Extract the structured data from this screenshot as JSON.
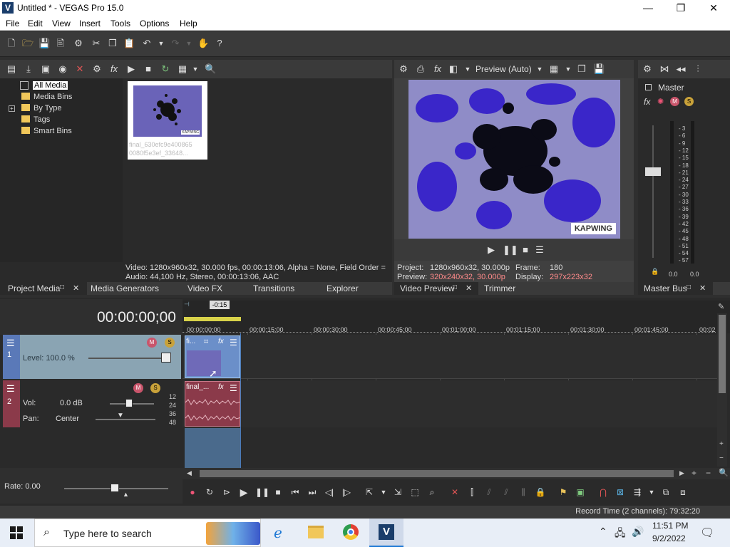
{
  "window": {
    "title": "Untitled * - VEGAS Pro 15.0",
    "app_icon_letter": "V",
    "minimize": "—",
    "maximize": "❐",
    "close": "✕"
  },
  "menu": [
    "File",
    "Edit",
    "View",
    "Insert",
    "Tools",
    "Options",
    "Help"
  ],
  "project_media": {
    "tree": [
      "All Media",
      "Media Bins",
      "By Type",
      "Tags",
      "Smart Bins"
    ],
    "expand_marker": "+",
    "thumbnail_caption": [
      "final_630efc9e400865",
      "0080f5e3ef_33648..."
    ],
    "thumbnail_watermark": "KAPWING",
    "info_video": "Video: 1280x960x32, 30.000 fps, 00:00:13:06, Alpha = None, Field Order =",
    "info_audio": "Audio: 44,100 Hz, Stereo, 00:00:13:06, AAC",
    "tabs": [
      "Project Media",
      "Media Generators",
      "Video FX",
      "Transitions",
      "Explorer"
    ],
    "tab_close": "✕"
  },
  "preview": {
    "mode": "Preview (Auto)",
    "watermark": "KAPWING",
    "project_label": "Project:",
    "project_value": "1280x960x32, 30.000p",
    "preview_label": "Preview:",
    "preview_value": "320x240x32, 30.000p",
    "frame_label": "Frame:",
    "frame_value": "180",
    "display_label": "Display:",
    "display_value": "297x223x32",
    "tabs": [
      "Video Preview",
      "Trimmer"
    ],
    "tab_close": "✕"
  },
  "master": {
    "label": "Master",
    "scale": [
      "3",
      "6",
      "9",
      "12",
      "15",
      "18",
      "21",
      "24",
      "27",
      "30",
      "33",
      "36",
      "39",
      "42",
      "45",
      "48",
      "51",
      "54",
      "57"
    ],
    "left_value": "0.0",
    "right_value": "0.0",
    "tab": "Master Bus",
    "tab_close": "✕"
  },
  "timeline": {
    "timecode": "00:00:00;00",
    "cursor_offset": "-0:15",
    "ruler": [
      "00:00:00;00",
      "00:00:15;00",
      "00:00:30;00",
      "00:00:45;00",
      "00:01:00;00",
      "00:01:15;00",
      "00:01:30;00",
      "00:01:45;00",
      "00:02"
    ],
    "video_track": {
      "number": "1",
      "level": "Level: 100.0 %",
      "clip_label": "fi..."
    },
    "audio_track": {
      "number": "2",
      "vol_label": "Vol:",
      "vol_value": "0.0 dB",
      "pan_label": "Pan:",
      "pan_value": "Center",
      "db_scale": [
        "12",
        "24",
        "36",
        "48"
      ],
      "clip_label": "final_..."
    },
    "rate": "Rate: 0.00"
  },
  "status": {
    "record_time": "Record Time (2 channels): 79:32:20"
  },
  "taskbar": {
    "search_placeholder": "Type here to search",
    "time": "11:51 PM",
    "date": "9/2/2022"
  },
  "colors": {
    "accent_blue": "#6b8fc9",
    "video_track_bg": "#8aa4b3",
    "audio_track_bg": "#8b3a4a",
    "preview_highlight": "#ff8a8a"
  }
}
